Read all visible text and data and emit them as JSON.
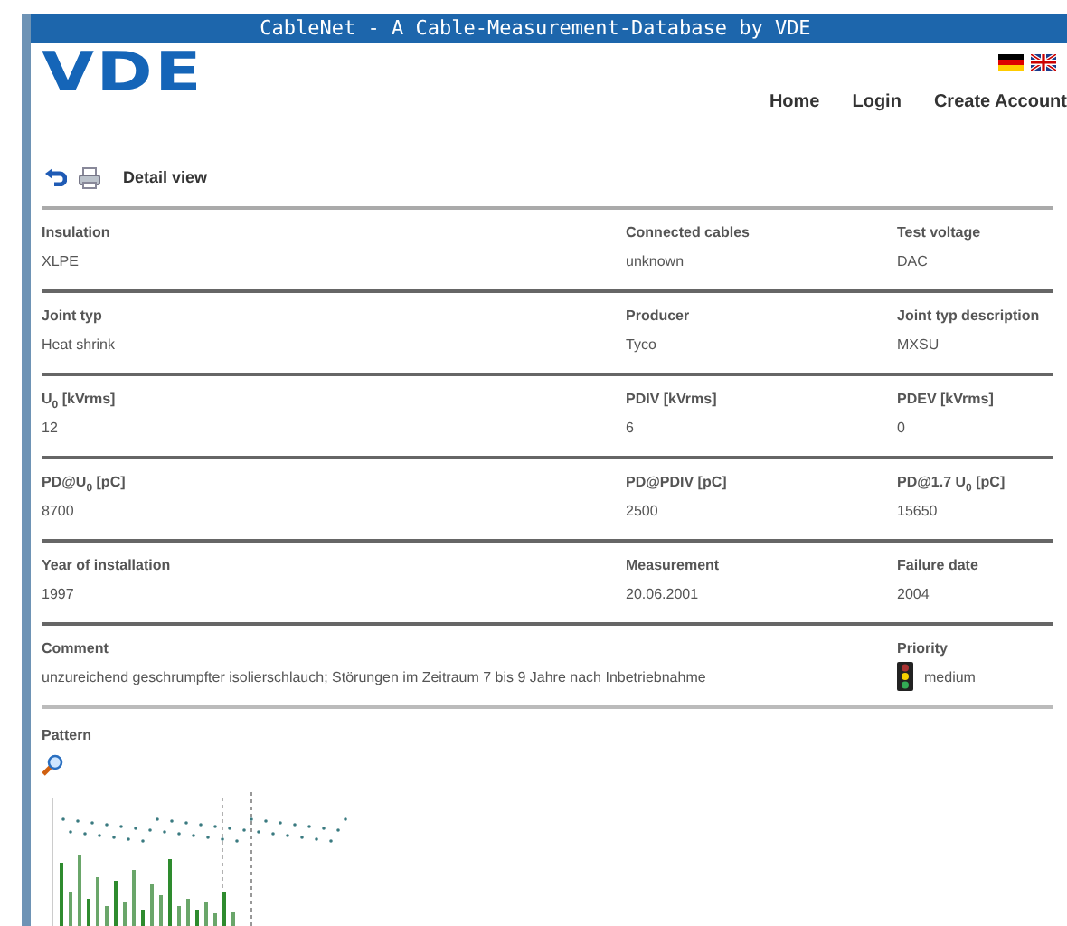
{
  "window": {
    "title": "CableNet - A Cable-Measurement-Database by VDE"
  },
  "logo": "VDE",
  "languages": [
    {
      "kind": "de"
    },
    {
      "kind": "en"
    }
  ],
  "nav": [
    "Home",
    "Login",
    "Create Account"
  ],
  "toolbar": {
    "title": "Detail view"
  },
  "rows": [
    {
      "cells": [
        {
          "kind": "text",
          "label": "Insulation",
          "value": "XLPE"
        },
        {
          "kind": "text",
          "label": "Connected cables",
          "value": "unknown"
        },
        {
          "kind": "text",
          "label": "Test voltage",
          "value": "DAC"
        }
      ]
    },
    {
      "cells": [
        {
          "kind": "text",
          "label": "Joint typ",
          "value": "Heat shrink"
        },
        {
          "kind": "text",
          "label": "Producer",
          "value": "Tyco"
        },
        {
          "kind": "text",
          "label": "Joint typ description",
          "value": "MXSU"
        }
      ]
    },
    {
      "cells": [
        {
          "kind": "text",
          "label": "U$_{0}$ [kVrms]",
          "value": "12"
        },
        {
          "kind": "text",
          "label": "PDIV [kVrms]",
          "value": "6"
        },
        {
          "kind": "text",
          "label": "PDEV [kVrms]",
          "value": "0"
        }
      ]
    },
    {
      "cells": [
        {
          "kind": "text",
          "label": "PD@U$_{0}$ [pC]",
          "value": "8700"
        },
        {
          "kind": "text",
          "label": "PD@PDIV [pC]",
          "value": "2500"
        },
        {
          "kind": "text",
          "label": "PD@1.7 U$_{0}$ [pC]",
          "value": "15650"
        }
      ]
    },
    {
      "cells": [
        {
          "kind": "text",
          "label": "Year of installation",
          "value": "1997"
        },
        {
          "kind": "text",
          "label": "Measurement",
          "value": "20.06.2001"
        },
        {
          "kind": "text",
          "label": "Failure date",
          "value": "2004"
        }
      ]
    },
    {
      "cells": [
        {
          "kind": "wide",
          "label": "Comment",
          "value": "unzureichend geschrumpfter isolierschlauch; Störungen im Zeitraum 7 bis 9 Jahre nach Inbetriebnahme"
        },
        {
          "kind": "priority",
          "label": "Priority",
          "value": "medium"
        }
      ]
    }
  ],
  "pattern": {
    "label": "Pattern"
  }
}
